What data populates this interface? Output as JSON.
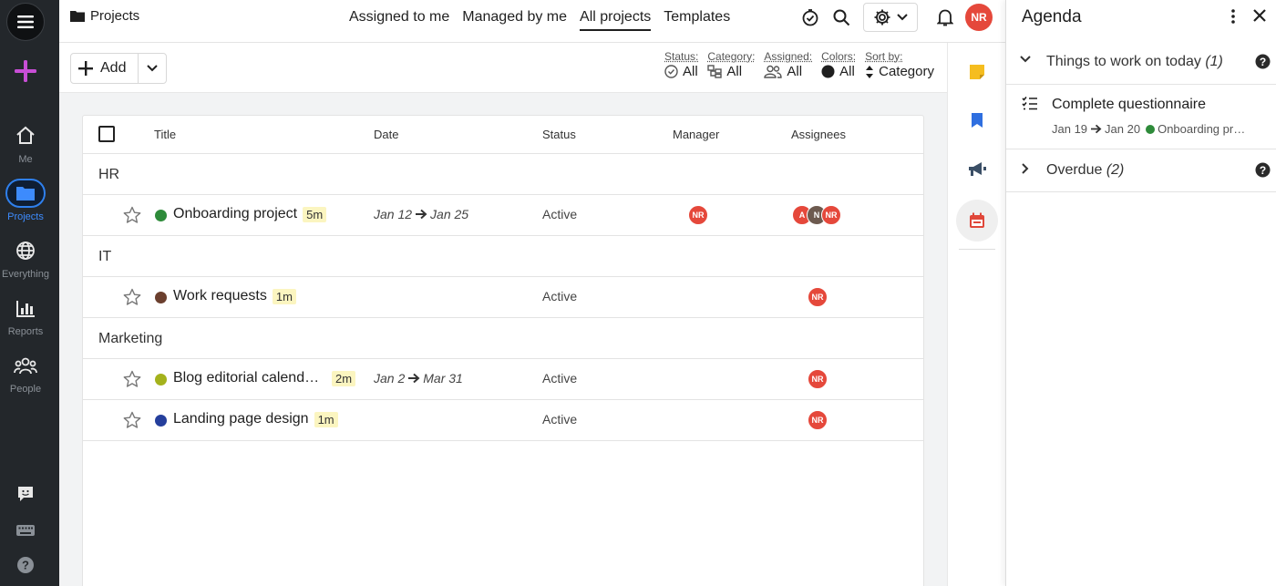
{
  "colors": {
    "sidebar_bg": "#23272b",
    "accent_blue": "#2f80ed",
    "avatar_red": "#e5483b",
    "plus_pink": "#c84ed6",
    "badge_bg": "#fbf5c0"
  },
  "sidebar": {
    "items": [
      {
        "label": "Me",
        "icon": "home-icon"
      },
      {
        "label": "Projects",
        "icon": "folder-icon",
        "active": true
      },
      {
        "label": "Everything",
        "icon": "globe-icon"
      },
      {
        "label": "Reports",
        "icon": "bar-chart-icon"
      },
      {
        "label": "People",
        "icon": "people-icon"
      }
    ]
  },
  "topbar": {
    "title": "Projects",
    "tabs": [
      {
        "label": "Assigned to me"
      },
      {
        "label": "Managed by me"
      },
      {
        "label": "All projects",
        "active": true
      },
      {
        "label": "Templates"
      }
    ],
    "user_initials": "NR"
  },
  "toolbar": {
    "add_label": "Add",
    "filters": [
      {
        "label": "Status:",
        "value": "All",
        "icon": "check-circle-icon"
      },
      {
        "label": "Category:",
        "value": "All",
        "icon": "category-icon"
      },
      {
        "label": "Assigned:",
        "value": "All",
        "icon": "people-outline-icon"
      },
      {
        "label": "Colors:",
        "value": "All",
        "icon": "color-dot-icon"
      },
      {
        "label": "Sort by:",
        "value": "Category",
        "icon": "sort-icon"
      }
    ]
  },
  "table": {
    "columns": [
      "Title",
      "Date",
      "Status",
      "Manager",
      "Assignees"
    ],
    "groups": [
      {
        "name": "HR",
        "rows": [
          {
            "title": "Onboarding project",
            "badge": "5m",
            "color": "#2e8b3a",
            "date_start": "Jan 12",
            "date_end": "Jan 25",
            "status": "Active",
            "manager": "NR",
            "assignees": [
              "A",
              "N",
              "NR"
            ]
          }
        ]
      },
      {
        "name": "IT",
        "rows": [
          {
            "title": "Work requests",
            "badge": "1m",
            "color": "#6b3f2e",
            "date_start": "",
            "date_end": "",
            "status": "Active",
            "manager": "",
            "assignees": [
              "NR"
            ]
          }
        ]
      },
      {
        "name": "Marketing",
        "rows": [
          {
            "title": "Blog editorial calenda…",
            "badge": "2m",
            "color": "#a4b21c",
            "date_start": "Jan 2",
            "date_end": "Mar 31",
            "status": "Active",
            "manager": "",
            "assignees": [
              "NR"
            ]
          },
          {
            "title": "Landing page design",
            "badge": "1m",
            "color": "#253f9c",
            "date_start": "",
            "date_end": "",
            "status": "Active",
            "manager": "",
            "assignees": [
              "NR"
            ]
          }
        ]
      }
    ]
  },
  "agenda": {
    "title": "Agenda",
    "today_label": "Things to work on today",
    "today_count": "(1)",
    "task": {
      "name": "Complete questionnaire",
      "date_start": "Jan 19",
      "date_end": "Jan 20",
      "project": "Onboarding pr…"
    },
    "overdue_label": "Overdue",
    "overdue_count": "(2)"
  }
}
